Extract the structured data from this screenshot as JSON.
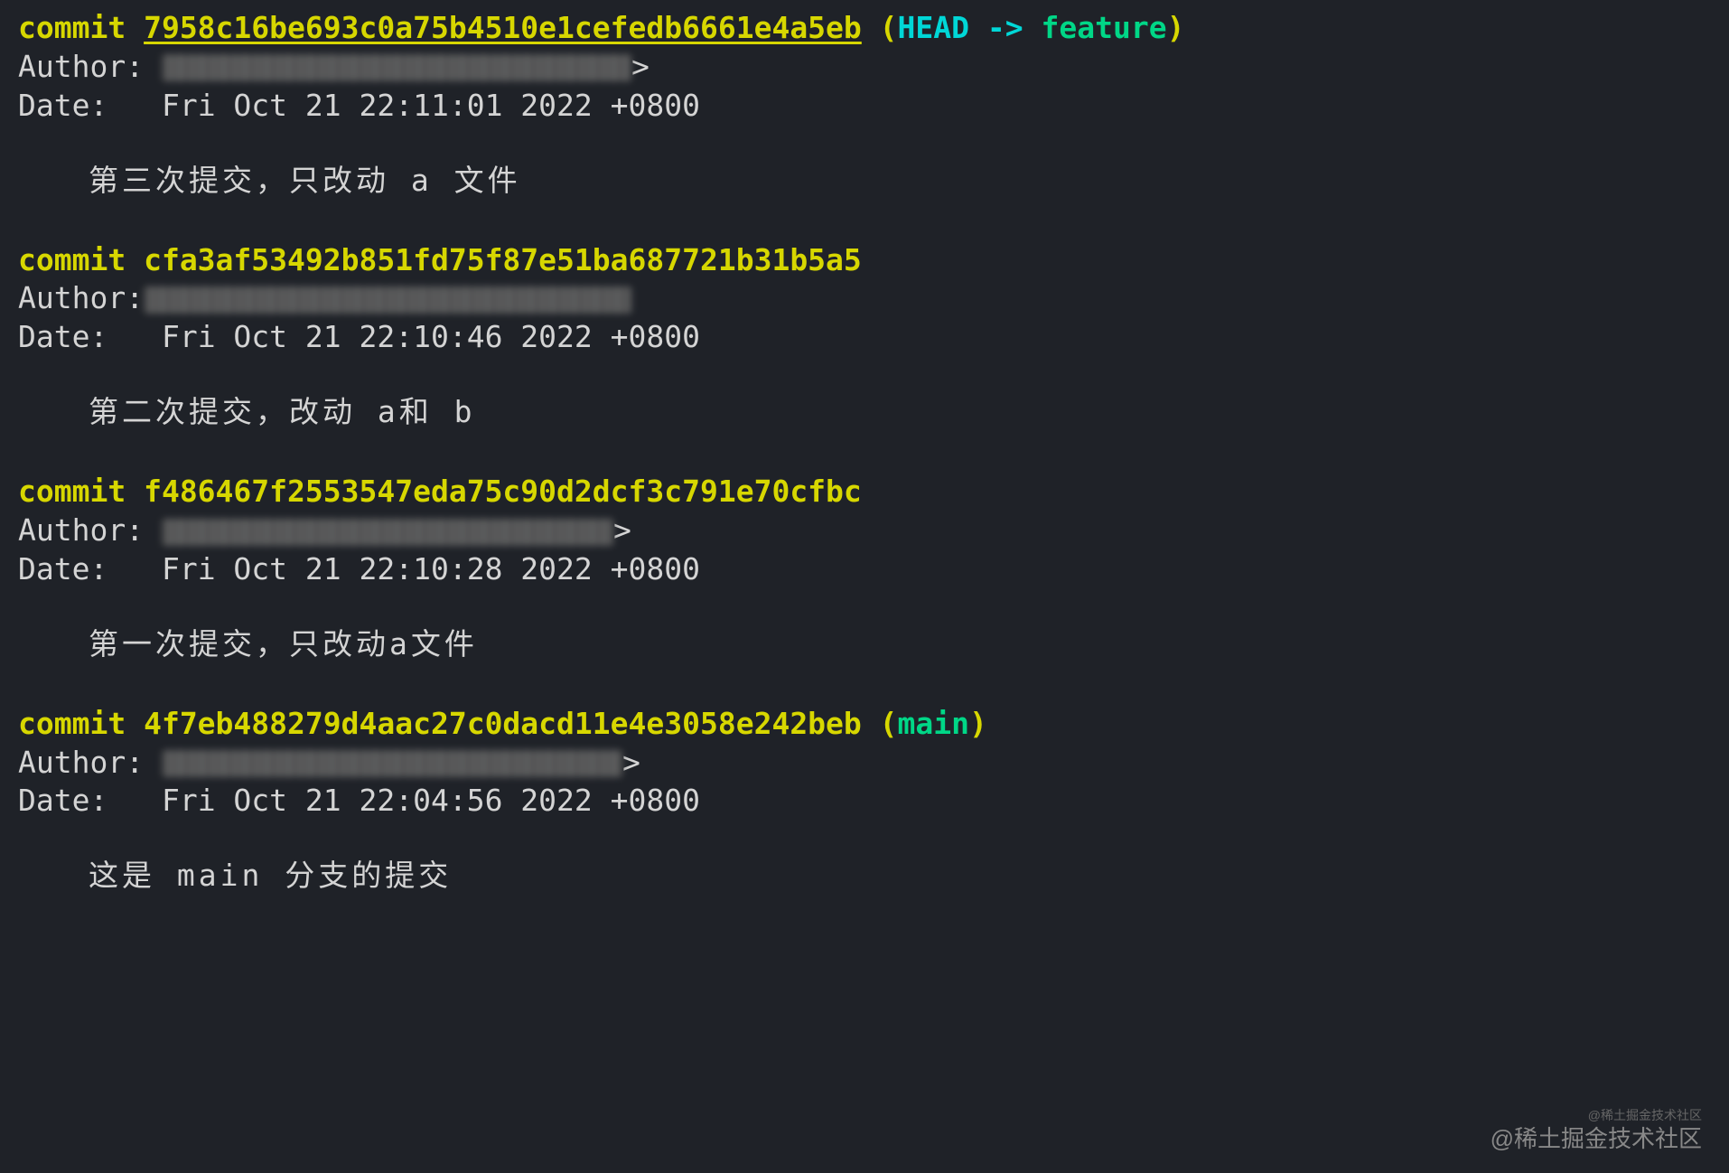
{
  "commits": [
    {
      "label": "commit ",
      "hash": "7958c16be693c0a75b4510e1cefedb6661e4a5eb",
      "hash_underlined": true,
      "refs_open": " (",
      "head": "HEAD -> ",
      "branch": "feature",
      "refs_close": ")",
      "author_label": "Author: ",
      "author_suffix": ">",
      "date_label": "Date:   ",
      "date_value": "Fri Oct 21 22:11:01 2022 +0800",
      "message": "第三次提交，只改动 a 文件"
    },
    {
      "label": "commit ",
      "hash": "cfa3af53492b851fd75f87e51ba687721b31b5a5",
      "hash_underlined": false,
      "refs_open": "",
      "head": "",
      "branch": "",
      "refs_close": "",
      "author_label": "Author:",
      "author_suffix": "",
      "date_label": "Date:   ",
      "date_value": "Fri Oct 21 22:10:46 2022 +0800",
      "message": "第二次提交，改动 a和 b"
    },
    {
      "label": "commit ",
      "hash": "f486467f2553547eda75c90d2dcf3c791e70cfbc",
      "hash_underlined": false,
      "refs_open": "",
      "head": "",
      "branch": "",
      "refs_close": "",
      "author_label": "Author: ",
      "author_suffix": ">",
      "date_label": "Date:   ",
      "date_value": "Fri Oct 21 22:10:28 2022 +0800",
      "message": "第一次提交，只改动a文件"
    },
    {
      "label": "commit ",
      "hash": "4f7eb488279d4aac27c0dacd11e4e3058e242beb",
      "hash_underlined": false,
      "refs_open": " (",
      "head": "",
      "branch": "main",
      "refs_close": ")",
      "author_label": "Author: ",
      "author_suffix": ">",
      "date_label": "Date:   ",
      "date_value": "Fri Oct 21 22:04:56 2022 +0800",
      "message": "这是 main 分支的提交"
    }
  ],
  "watermark": "@稀土掘金技术社区",
  "watermark_small": "@稀土掘金技术社区"
}
